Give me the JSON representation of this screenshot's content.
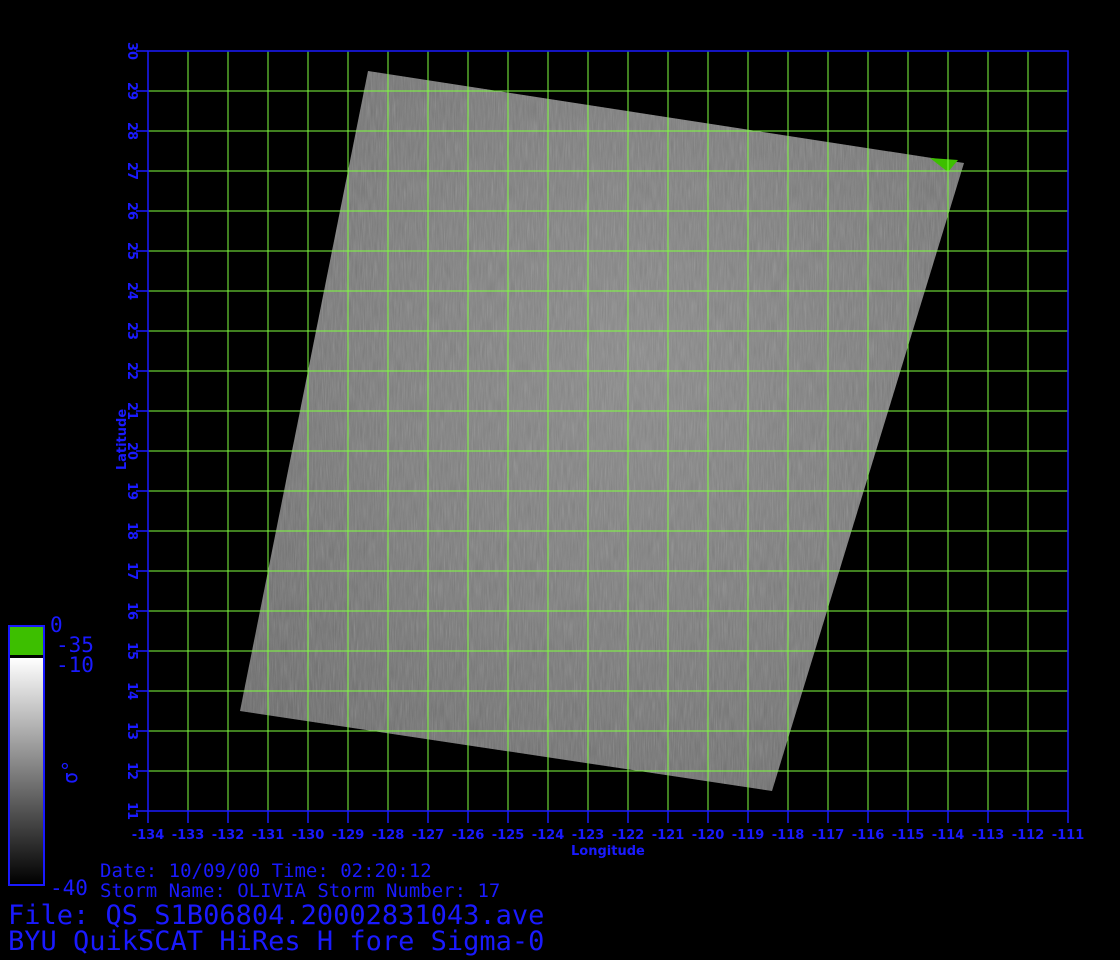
{
  "map": {
    "lon_range": [
      -134,
      -111
    ],
    "lat_range": [
      11,
      30
    ],
    "lon_ticks": [
      -134,
      -133,
      -132,
      -131,
      -130,
      -129,
      -128,
      -127,
      -126,
      -125,
      -124,
      -123,
      -122,
      -121,
      -120,
      -119,
      -118,
      -117,
      -116,
      -115,
      -114,
      -113,
      -112,
      -111
    ],
    "lat_ticks": [
      11,
      12,
      13,
      14,
      15,
      16,
      17,
      18,
      19,
      20,
      21,
      22,
      23,
      24,
      25,
      26,
      27,
      28,
      29,
      30
    ],
    "grid": true,
    "grid_color": "#7fff3f",
    "axis_color": "#1a1aff",
    "swath_corners_lonlat": [
      [
        -128.5,
        29.5
      ],
      [
        -113.6,
        27.2
      ],
      [
        -118.4,
        11.5
      ],
      [
        -131.7,
        13.5
      ]
    ],
    "xlabel": "Longitude",
    "ylabel": "Latitude"
  },
  "colorbar": {
    "max_label": "0",
    "range_labels": [
      "-35",
      "-10"
    ],
    "min_label": "-40",
    "symbol": "σ°",
    "land_color": "#3dbf00"
  },
  "info": {
    "date_line": "Date: 10/09/00   Time: 02:20:12",
    "storm_line": "Storm  Name: OLIVIA   Storm  Number: 17",
    "file_line": "File: QS_S1B06804.20002831043.ave",
    "title_line": "BYU QuikSCAT HiRes H fore Sigma-0"
  }
}
